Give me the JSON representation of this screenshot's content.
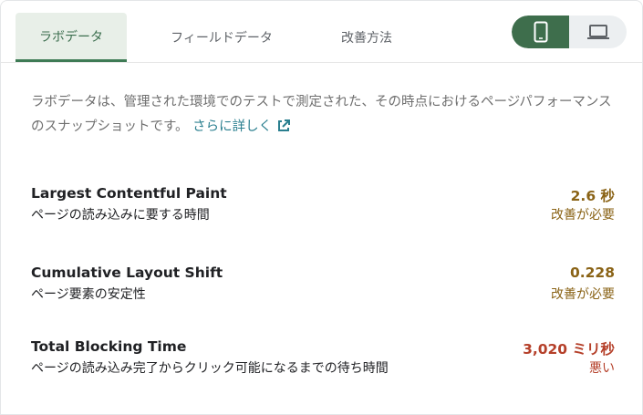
{
  "tabs": [
    {
      "label": "ラボデータ",
      "active": true
    },
    {
      "label": "フィールドデータ",
      "active": false
    },
    {
      "label": "改善方法",
      "active": false
    }
  ],
  "device_toggle": {
    "selected": "mobile",
    "mobile_icon": "smartphone-icon",
    "desktop_icon": "laptop-icon",
    "active_color": "#3e6e4c"
  },
  "description": {
    "text": "ラボデータは、管理された環境でのテストで測定された、その時点におけるページパフォーマンスのスナップショットです。",
    "link_label": "さらに詳しく",
    "link_icon": "external-link-icon"
  },
  "colors": {
    "needs_improvement": "#8a6316",
    "poor": "#b5402a",
    "link": "#2a7f8f",
    "tab_active_bg": "#e8efe8"
  },
  "metrics": [
    {
      "name": "Largest Contentful Paint",
      "description": "ページの読み込みに要する時間",
      "value": "2.6 秒",
      "status": "改善が必要",
      "rating": "needs_improvement"
    },
    {
      "name": "Cumulative Layout Shift",
      "description": "ページ要素の安定性",
      "value": "0.228",
      "status": "改善が必要",
      "rating": "needs_improvement"
    },
    {
      "name": "Total Blocking Time",
      "description": "ページの読み込み完了からクリック可能になるまでの待ち時間",
      "value": "3,020 ミリ秒",
      "status": "悪い",
      "rating": "poor"
    }
  ]
}
